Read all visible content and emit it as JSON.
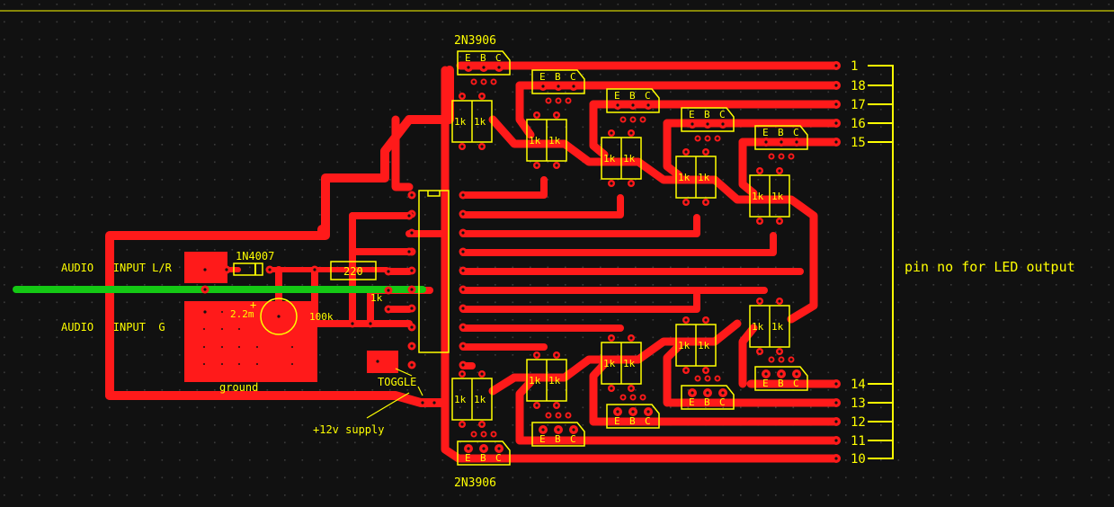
{
  "colors": {
    "background": "#111111",
    "grid_dot": "#3a3a3a",
    "copper": "#ff1a1a",
    "silkscreen": "#ffff00",
    "wire": "#14c814",
    "pad_hole": "#111111"
  },
  "labels": {
    "transistor_top": "2N3906",
    "transistor_bottom": "2N3906",
    "audio_lr": "AUDIO   INPUT L/R",
    "audio_g": "AUDIO   INPUT  G",
    "diode": "1N4007",
    "resistor_220": "220",
    "resistor_1k": "1k",
    "resistor_100k": "100k",
    "cap": "2.2m",
    "cap_plus": "+",
    "ground": "ground",
    "toggle": "TOGGLE",
    "supply": "+12v supply",
    "pin_caption": "pin no for LED output",
    "ebc": [
      "E",
      "B",
      "C"
    ],
    "res_pair": "1k"
  },
  "output_pins_top": [
    "1",
    "18",
    "17",
    "16",
    "15"
  ],
  "output_pins_bottom": [
    "14",
    "13",
    "12",
    "11",
    "10"
  ]
}
